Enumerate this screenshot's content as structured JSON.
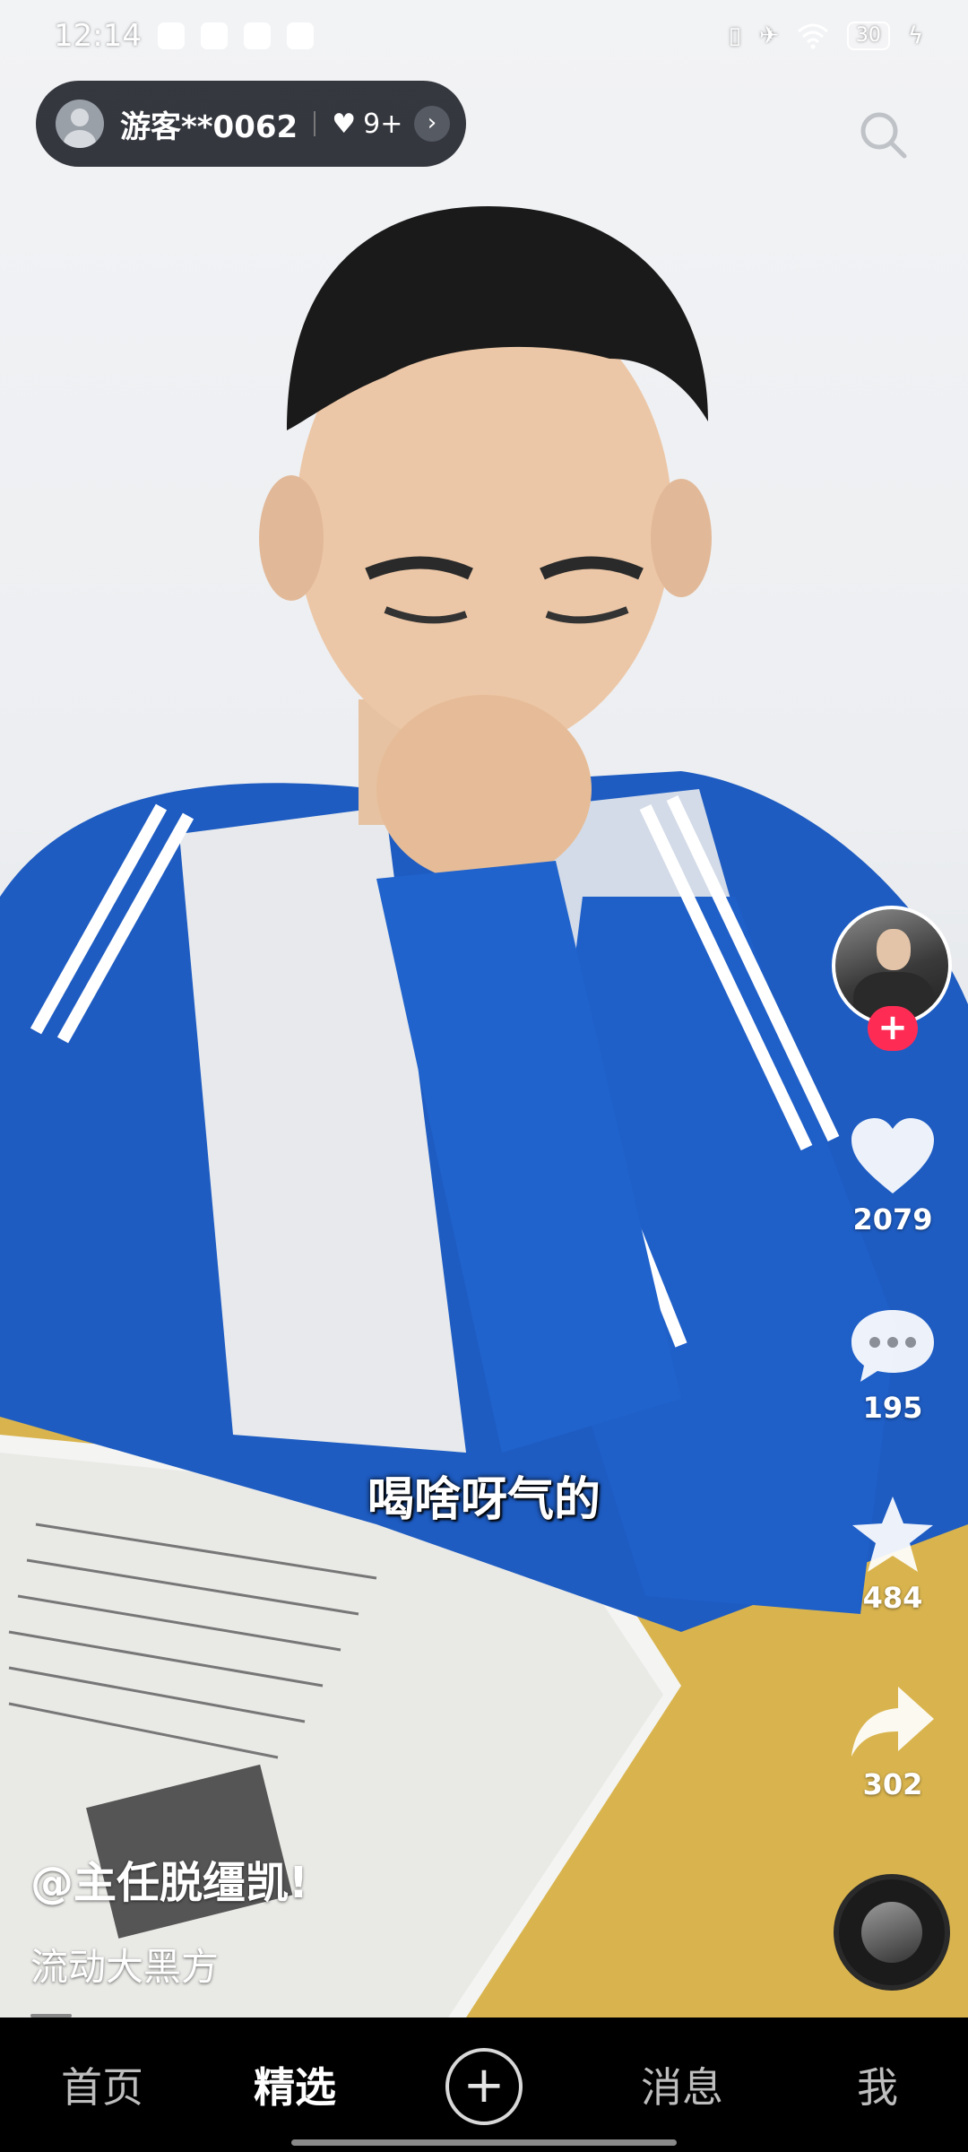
{
  "status_bar": {
    "time": "12:14",
    "battery": "30"
  },
  "top_user": {
    "name": "游客**0062",
    "like_count": "9+",
    "heart_icon": "♥",
    "arrow_icon": "›"
  },
  "subtitle": "喝啥呀气的",
  "actions": {
    "follow_icon": "+",
    "likes": "2079",
    "comments": "195",
    "favorites": "484",
    "shares": "302"
  },
  "caption": {
    "author": "@主任脱缰凯!",
    "description": "流动大黑方"
  },
  "bottom_nav": {
    "items": [
      "首页",
      "精选",
      "消息",
      "我"
    ],
    "plus_icon": "+",
    "active": "精选"
  },
  "colors": {
    "accent": "#fe2c55",
    "nav_bg": "#000000",
    "pill_bg": "#14161e"
  }
}
